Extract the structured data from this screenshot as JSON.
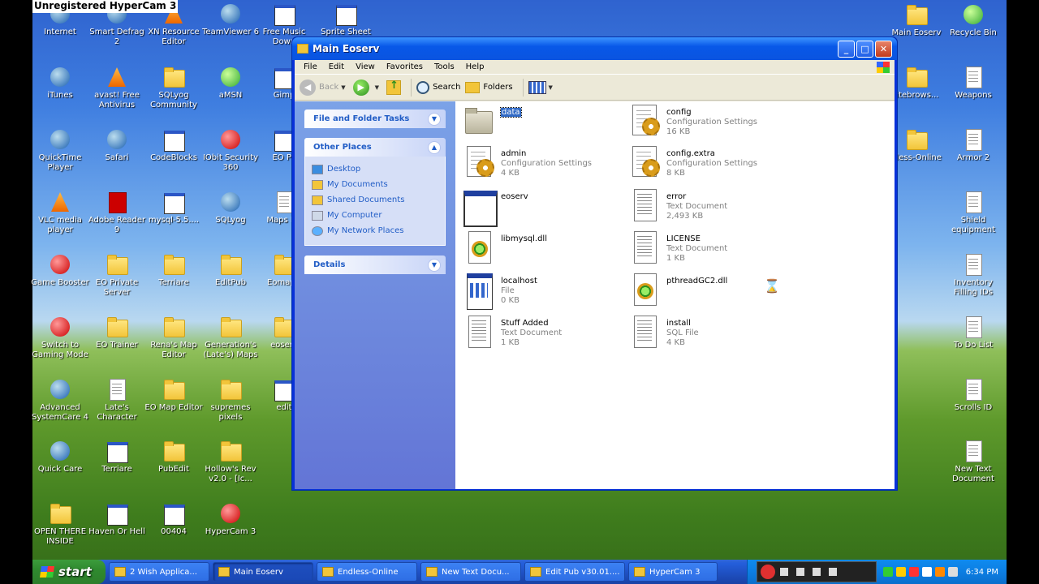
{
  "overlay": {
    "watermark": "Unregistered HyperCam 3"
  },
  "desktop": {
    "icons": [
      {
        "label": "Internet",
        "icon": "ie-icon"
      },
      {
        "label": "Smart Defrag 2",
        "icon": "defrag-icon"
      },
      {
        "label": "XN Resource Editor",
        "icon": "xn-icon"
      },
      {
        "label": "TeamViewer 6",
        "icon": "teamviewer-icon"
      },
      {
        "label": "Free Music Down",
        "icon": "music-icon"
      },
      {
        "label": "Sprite Sheet",
        "icon": "sprite-icon"
      },
      {
        "label": "iTunes",
        "icon": "itunes-icon"
      },
      {
        "label": "avast! Free Antivirus",
        "icon": "avast-icon"
      },
      {
        "label": "SQLyog Community",
        "icon": "folder-icon"
      },
      {
        "label": "aMSN",
        "icon": "amsn-icon"
      },
      {
        "label": "Gimp",
        "icon": "gimp-icon"
      },
      {
        "label": "QuickTime Player",
        "icon": "quicktime-icon"
      },
      {
        "label": "Safari",
        "icon": "safari-icon"
      },
      {
        "label": "CodeBlocks",
        "icon": "app-icon"
      },
      {
        "label": "IObit Security 360",
        "icon": "iobit-icon"
      },
      {
        "label": "EO Pa",
        "icon": "app-icon"
      },
      {
        "label": "VLC media player",
        "icon": "vlc-icon"
      },
      {
        "label": "Adobe Reader 9",
        "icon": "pdf-icon"
      },
      {
        "label": "mysql-5.5....",
        "icon": "mysql-icon"
      },
      {
        "label": "SQLyog",
        "icon": "sqlyog-icon"
      },
      {
        "label": "Maps Fix",
        "icon": "doc-icon"
      },
      {
        "label": "Game Booster",
        "icon": "booster-icon"
      },
      {
        "label": "EO Private Server",
        "icon": "folder-icon"
      },
      {
        "label": "Terriare",
        "icon": "folder-icon"
      },
      {
        "label": "EditPub",
        "icon": "folder-icon"
      },
      {
        "label": "Eomap r",
        "icon": "folder-icon"
      },
      {
        "label": "Switch to Gaming Mode",
        "icon": "booster-icon"
      },
      {
        "label": "EO Trainer",
        "icon": "folder-icon"
      },
      {
        "label": "Rena's Map Editor",
        "icon": "folder-icon"
      },
      {
        "label": "Generation's (Late's) Maps",
        "icon": "folder-icon"
      },
      {
        "label": "eoserv",
        "icon": "folder-icon"
      },
      {
        "label": "Advanced SystemCare 4",
        "icon": "systemcare-icon"
      },
      {
        "label": "Late's Character",
        "icon": "doc-icon"
      },
      {
        "label": "EO Map Editor",
        "icon": "folder-icon"
      },
      {
        "label": "supremes pixels",
        "icon": "folder-icon"
      },
      {
        "label": "edit",
        "icon": "app-icon"
      },
      {
        "label": "Quick Care",
        "icon": "systemcare-icon"
      },
      {
        "label": "Terriare",
        "icon": "app-icon"
      },
      {
        "label": "PubEdit",
        "icon": "folder-icon"
      },
      {
        "label": "Hollow's Rev v2.0 - [Ic...",
        "icon": "folder-icon"
      },
      {
        "label": "OPEN THERE INSIDE",
        "icon": "folder-icon"
      },
      {
        "label": "Haven Or Hell",
        "icon": "image-icon"
      },
      {
        "label": "00404",
        "icon": "image-icon"
      },
      {
        "label": "HyperCam 3",
        "icon": "hypercam-icon"
      },
      {
        "label": "Main Eoserv",
        "icon": "folder-icon"
      },
      {
        "label": "Recycle Bin",
        "icon": "recycle-icon"
      },
      {
        "label": "litebrows...",
        "icon": "folder-icon"
      },
      {
        "label": "Weapons",
        "icon": "doc-icon"
      },
      {
        "label": "dless-Online",
        "icon": "folder-icon"
      },
      {
        "label": "Armor 2",
        "icon": "doc-icon"
      },
      {
        "label": "Shield equipment",
        "icon": "doc-icon"
      },
      {
        "label": "Inventory Filling IDs",
        "icon": "doc-icon"
      },
      {
        "label": "To Do List",
        "icon": "doc-icon"
      },
      {
        "label": "Scrolls ID",
        "icon": "doc-icon"
      },
      {
        "label": "New Text Document",
        "icon": "doc-icon"
      }
    ]
  },
  "window": {
    "title": "Main Eoserv",
    "menu": [
      "File",
      "Edit",
      "View",
      "Favorites",
      "Tools",
      "Help"
    ],
    "toolbar": {
      "back": "Back",
      "search": "Search",
      "folders": "Folders"
    },
    "panels": {
      "tasks": "File and Folder Tasks",
      "places": "Other Places",
      "details": "Details",
      "place_links": [
        "Desktop",
        "My Documents",
        "Shared Documents",
        "My Computer",
        "My Network Places"
      ]
    },
    "files": [
      {
        "name": "data",
        "type": "",
        "size": "",
        "icon": "folder-icon"
      },
      {
        "name": "config",
        "type": "Configuration Settings",
        "size": "16 KB",
        "icon": "config-icon"
      },
      {
        "name": "admin",
        "type": "Configuration Settings",
        "size": "4 KB",
        "icon": "config-icon"
      },
      {
        "name": "config.extra",
        "type": "Configuration Settings",
        "size": "8 KB",
        "icon": "config-icon"
      },
      {
        "name": "eoserv",
        "type": "",
        "size": "",
        "icon": "exe-icon"
      },
      {
        "name": "error",
        "type": "Text Document",
        "size": "2,493 KB",
        "icon": "text-icon"
      },
      {
        "name": "libmysql.dll",
        "type": "",
        "size": "",
        "icon": "dll-icon"
      },
      {
        "name": "LICENSE",
        "type": "Text Document",
        "size": "1 KB",
        "icon": "text-icon"
      },
      {
        "name": "localhost",
        "type": "File",
        "size": "0 KB",
        "icon": "file-icon"
      },
      {
        "name": "pthreadGC2.dll",
        "type": "",
        "size": "",
        "icon": "dll-icon"
      },
      {
        "name": "Stuff Added",
        "type": "Text Document",
        "size": "1 KB",
        "icon": "text-icon"
      },
      {
        "name": "install",
        "type": "SQL File",
        "size": "4 KB",
        "icon": "text-icon"
      }
    ]
  },
  "taskbar": {
    "start": "start",
    "tasks": [
      "2 Wish Applica...",
      "Main Eoserv",
      "Endless-Online",
      "New Text Docu...",
      "Edit Pub v30.01....",
      "HyperCam 3"
    ],
    "clock": "6:34 PM"
  }
}
